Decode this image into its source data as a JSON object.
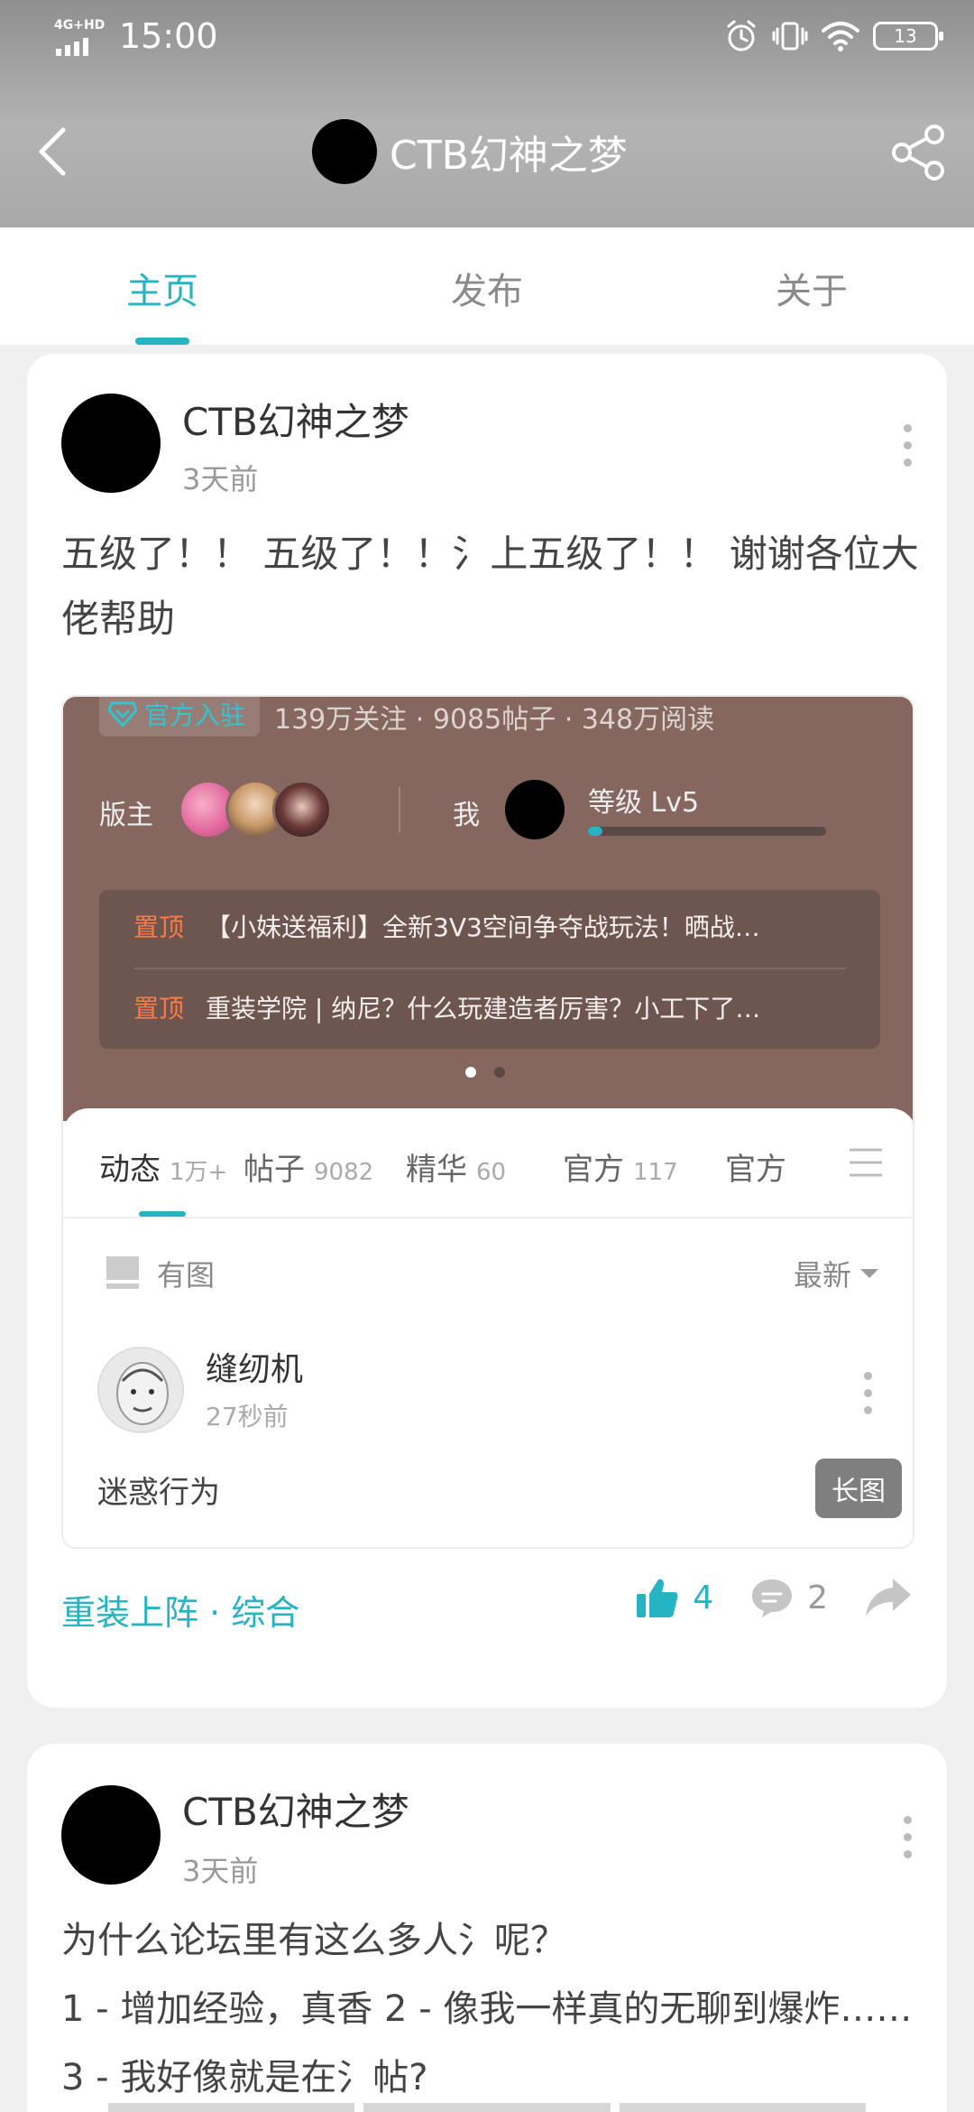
{
  "status_bar": {
    "network": "4G+HD",
    "time": "15:00",
    "battery": "13"
  },
  "header": {
    "title": "CTB幻神之梦"
  },
  "tabs": [
    {
      "label": "主页",
      "active": true
    },
    {
      "label": "发布",
      "active": false
    },
    {
      "label": "关于",
      "active": false
    }
  ],
  "posts": [
    {
      "author": "CTB幻神之梦",
      "time": "3天前",
      "text": "五级了！！ 五级了！！氵上五级了！！ 谢谢各位大佬帮助",
      "image": {
        "official_badge": "官方入驻",
        "stats": "139万关注 · 9085帖子 · 348万阅读",
        "moderator_label": "版主",
        "me_label": "我",
        "level": "等级 Lv5",
        "level_progress": 0.06,
        "pinned": [
          {
            "tag": "置顶",
            "text": "【小妹送福利】全新3V3空间争夺战玩法！晒战…"
          },
          {
            "tag": "置顶",
            "text": "重装学院 |  纳尼？什么玩建造者厉害？小工下了…"
          }
        ],
        "tabs": [
          {
            "label": "动态",
            "count": "1万+",
            "active": true
          },
          {
            "label": "帖子",
            "count": "9082",
            "active": false
          },
          {
            "label": "精华",
            "count": "60",
            "active": false
          },
          {
            "label": "官方",
            "count": "117",
            "active": false
          },
          {
            "label": "官方",
            "count": "",
            "active": false
          }
        ],
        "filter_label": "有图",
        "sort_label": "最新",
        "inner_post": {
          "author": "缝纫机",
          "time": "27秒前",
          "text": "迷惑行为",
          "badge": "长图"
        }
      },
      "tags": "重装上阵 · 综合",
      "likes": "4",
      "comments": "2"
    },
    {
      "author": "CTB幻神之梦",
      "time": "3天前",
      "text_line1": "为什么论坛里有这么多人氵呢？",
      "text_line2": "1 - 增加经验，真香 2 - 像我一样真的无聊到爆炸…… 3 - 我好像就是在氵帖?"
    }
  ],
  "colors": {
    "accent": "#26b3c2",
    "pin_tag": "#ff7a45",
    "embed_bg": "#85675f"
  }
}
